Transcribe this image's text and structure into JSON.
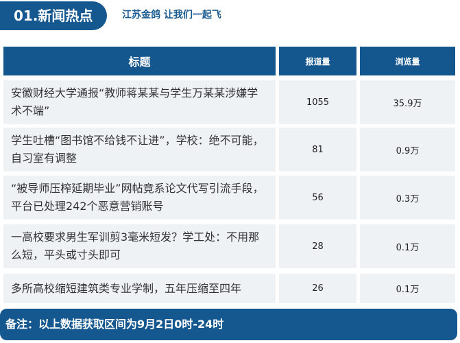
{
  "header": {
    "section_title": "01.新闻热点",
    "slogan": "江苏金鸽 让我们一起飞"
  },
  "table": {
    "columns": [
      "标题",
      "报道量",
      "浏览量"
    ],
    "rows": [
      {
        "title": "安徽财经大学通报“教师蒋某某与学生万某某涉嫌学术不端”",
        "reports": "1055",
        "views": "35.9万"
      },
      {
        "title": "学生吐槽“图书馆不给钱不让进”，学校：绝不可能，自习室有调整",
        "reports": "81",
        "views": "0.9万"
      },
      {
        "title": "“被导师压榨延期毕业”网帖竟系论文代写引流手段，平台已处理242个恶意营销账号",
        "reports": "56",
        "views": "0.3万"
      },
      {
        "title": "一高校要求男生军训剪3毫米短发？学工处：不用那么短，平头或寸头即可",
        "reports": "28",
        "views": "0.1万"
      },
      {
        "title": "多所高校缩短建筑类专业学制，五年压缩至四年",
        "reports": "26",
        "views": "0.1万"
      }
    ]
  },
  "footer": {
    "note": "备注：以上数据获取区间为9月2日0时-24时"
  },
  "colors": {
    "brand_blue": "#15578f",
    "row_bg": "#eff2f5"
  }
}
